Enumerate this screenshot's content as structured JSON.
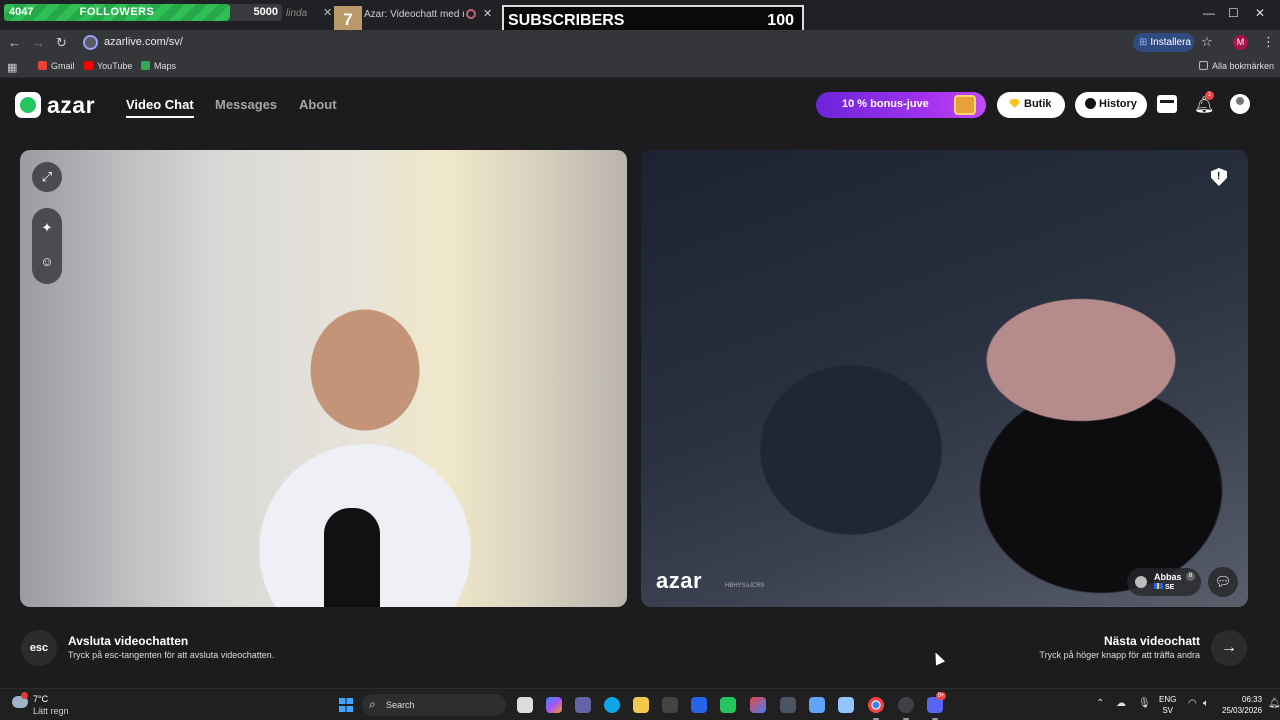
{
  "overlay": {
    "followers_current": "4047",
    "followers_label": "FOLLOWERS",
    "followers_goal": "5000",
    "subscribers_count_badge": "7",
    "subscribers_label": "SUBSCRIBERS",
    "subscribers_goal": "100"
  },
  "browser": {
    "tab_fragment": "linda",
    "active_tab_title": "Azar: Videochatt med nya m",
    "url": "azarlive.com/sv/",
    "install_label": "Installera",
    "profile_initial": "M",
    "bookmarks": [
      {
        "label": "Gmail",
        "color": "#ea4335"
      },
      {
        "label": "YouTube",
        "color": "#ff0000"
      },
      {
        "label": "Maps",
        "color": "#34a853"
      }
    ],
    "all_bookmarks": "Alla bokmärken"
  },
  "app": {
    "brand": "azar",
    "nav": [
      "Video Chat",
      "Messages",
      "About"
    ],
    "bonus_label": "10 % bonus-juve",
    "shop_label": "Butik",
    "history_label": "History",
    "notification_count": "1"
  },
  "remote": {
    "watermark": "azar",
    "watermark_id": "HBHYSoJCR9",
    "peer_name": "Abbas",
    "peer_age": "8",
    "peer_country": "SE"
  },
  "footer": {
    "end_key": "esc",
    "end_title": "Avsluta videochatten",
    "end_subtitle": "Tryck på esc-tangenten för att avsluta videochatten.",
    "next_title": "Nästa videochatt",
    "next_subtitle": "Tryck på höger knapp för att träffa andra"
  },
  "taskbar": {
    "temperature": "7°C",
    "condition": "Lätt regn",
    "search_label": "Search",
    "lang_top": "ENG",
    "lang_bottom": "SV",
    "time": "06:33",
    "date": "25/03/2026",
    "discord_badge": "9+"
  },
  "colors": {
    "accent_green": "#22c55e",
    "bonus_purple": "#8b2cf0",
    "followers_bar": "#2fbf55"
  }
}
